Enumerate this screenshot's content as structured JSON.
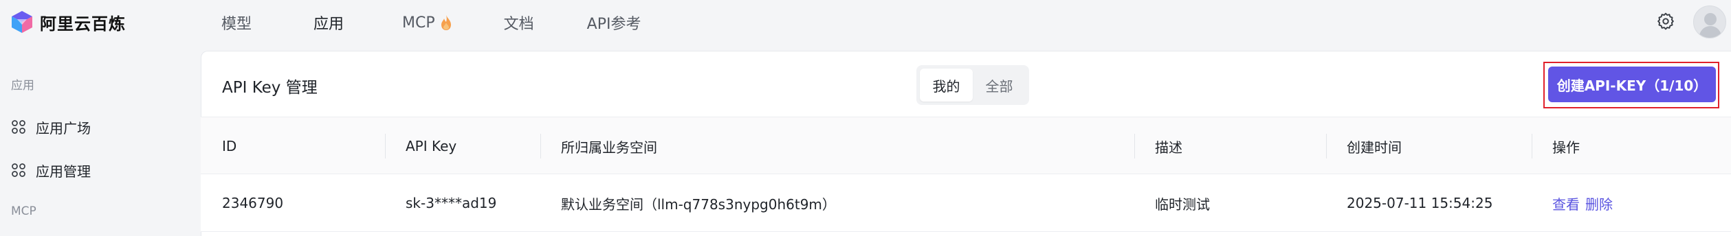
{
  "brand": {
    "name": "阿里云百炼"
  },
  "nav": {
    "items": [
      {
        "label": "模型"
      },
      {
        "label": "应用"
      },
      {
        "label": "MCP"
      },
      {
        "label": "文档"
      },
      {
        "label": "API参考"
      }
    ],
    "active": "应用",
    "settings_icon": "gear-icon",
    "avatar": "user-avatar"
  },
  "sidebar": {
    "section_app": "应用",
    "items": [
      {
        "label": "应用广场",
        "icon": "grid-icon"
      },
      {
        "label": "应用管理",
        "icon": "grid-icon"
      }
    ],
    "section_mcp": "MCP"
  },
  "page": {
    "title": "API Key 管理",
    "filter": {
      "options": [
        "我的",
        "全部"
      ],
      "selected": "我的"
    },
    "create_button": "创建API-KEY（1/10）"
  },
  "table": {
    "columns": [
      "ID",
      "API Key",
      "所归属业务空间",
      "描述",
      "创建时间",
      "操作"
    ],
    "rows": [
      {
        "id": "2346790",
        "api_key": "sk-3****ad19",
        "workspace": "默认业务空间（llm-q778s3nypg0h6t9m）",
        "description": "临时测试",
        "created_at": "2025-07-11 15:54:25",
        "actions": [
          "查看",
          "删除"
        ]
      }
    ]
  },
  "colors": {
    "accent": "#6155e5",
    "link": "#5a54e0",
    "highlight": "#e0202b",
    "background": "#f4f5f7"
  }
}
